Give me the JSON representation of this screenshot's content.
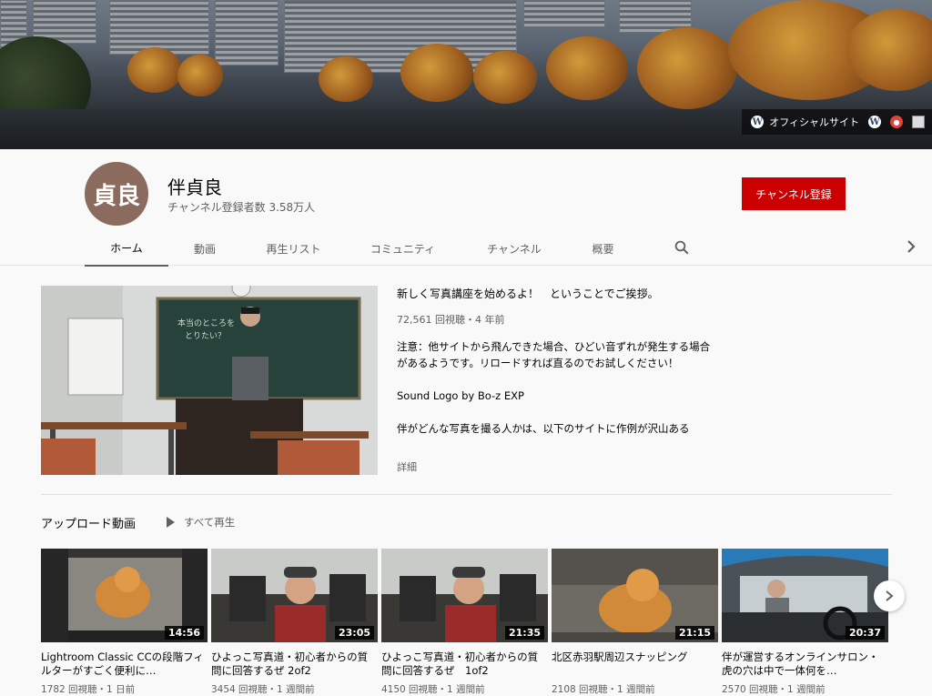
{
  "banner": {
    "links": [
      {
        "label": "オフィシャルサイト",
        "icon": "wordpress-icon"
      },
      {
        "label": "",
        "icon": "wordpress-icon"
      },
      {
        "label": "",
        "icon": "record-icon"
      },
      {
        "label": "",
        "icon": "profile-picture-icon"
      }
    ]
  },
  "channel": {
    "avatar_text": "貞良",
    "name": "伴貞良",
    "subscribers": "チャンネル登録者数 3.58万人",
    "subscribe_label": "チャンネル登録"
  },
  "tabs": [
    {
      "label": "ホーム",
      "active": true
    },
    {
      "label": "動画"
    },
    {
      "label": "再生リスト"
    },
    {
      "label": "コミュニティ"
    },
    {
      "label": "チャンネル"
    },
    {
      "label": "概要"
    }
  ],
  "featured": {
    "title": "新しく写真講座を始めるよ！　ということでご挨拶。",
    "meta": "72,561 回視聴・4 年前",
    "description": "注意：他サイトから飛んできた場合、ひどい音ずれが発生する場合があるようです。リロードすれば直るのでお試しください！\n\nSound Logo by Bo-z EXP\n\n伴がどんな写真を撮る人かは、以下のサイトに作例が沢山ある",
    "more": "詳細",
    "board_text": "本当のところを\nとりたい？"
  },
  "uploads": {
    "title": "アップロード動画",
    "play_all": "すべて再生",
    "videos": [
      {
        "title": "Lightroom Classic CCの段階フィルターがすごく便利に…",
        "meta": "1782 回視聴・1 日前",
        "duration": "14:56"
      },
      {
        "title": "ひよっこ写真道・初心者からの質問に回答するぜ 2of2",
        "meta": "3454 回視聴・1 週間前",
        "duration": "23:05"
      },
      {
        "title": "ひよっこ写真道・初心者からの質問に回答するぜ　1of2",
        "meta": "4150 回視聴・1 週間前",
        "duration": "21:35"
      },
      {
        "title": "北区赤羽駅周辺スナッピング",
        "meta": "2108 回視聴・1 週間前",
        "duration": "21:15"
      },
      {
        "title": "伴が運営するオンラインサロン・虎の穴は中で一体何を…",
        "meta": "2570 回視聴・1 週間前",
        "duration": "20:37"
      }
    ]
  }
}
